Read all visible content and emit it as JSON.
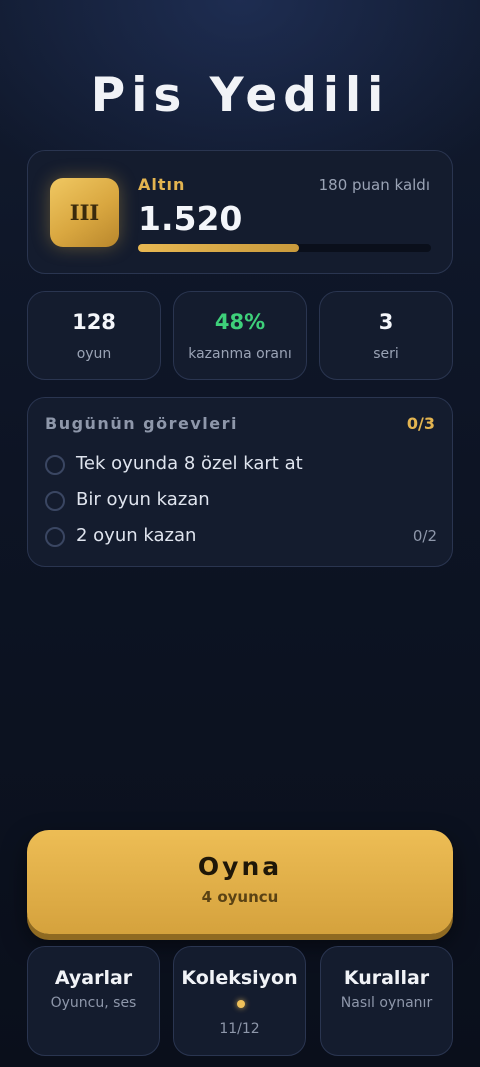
{
  "title": "Pis Yedili",
  "rank": {
    "badge": "III",
    "tier": "Altın",
    "points": "1.520",
    "remaining": "180 puan kaldı",
    "progress_fraction": 0.55
  },
  "stats": [
    {
      "value": "128",
      "label": "oyun"
    },
    {
      "value": "48%",
      "label": "kazanma oranı"
    },
    {
      "value": "3",
      "label": "seri"
    }
  ],
  "tasks": {
    "title": "Bugünün görevleri",
    "count": "0/3",
    "items": [
      {
        "text": "Tek oyunda 8 özel kart at",
        "progress": ""
      },
      {
        "text": "Bir oyun kazan",
        "progress": ""
      },
      {
        "text": "2 oyun kazan",
        "progress": "0/2"
      }
    ]
  },
  "play": {
    "label": "Oyna",
    "sub": "4 oyuncu"
  },
  "menu": [
    {
      "title": "Ayarlar",
      "sub": "Oyuncu, ses"
    },
    {
      "title": "Koleksiyon",
      "count": "11/12",
      "new_indicator": true
    },
    {
      "title": "Kurallar",
      "sub": "Nasıl oynanır"
    }
  ],
  "colors": {
    "accent": "#e3b450",
    "positive": "#3ed07a",
    "background": "#0d1424"
  }
}
